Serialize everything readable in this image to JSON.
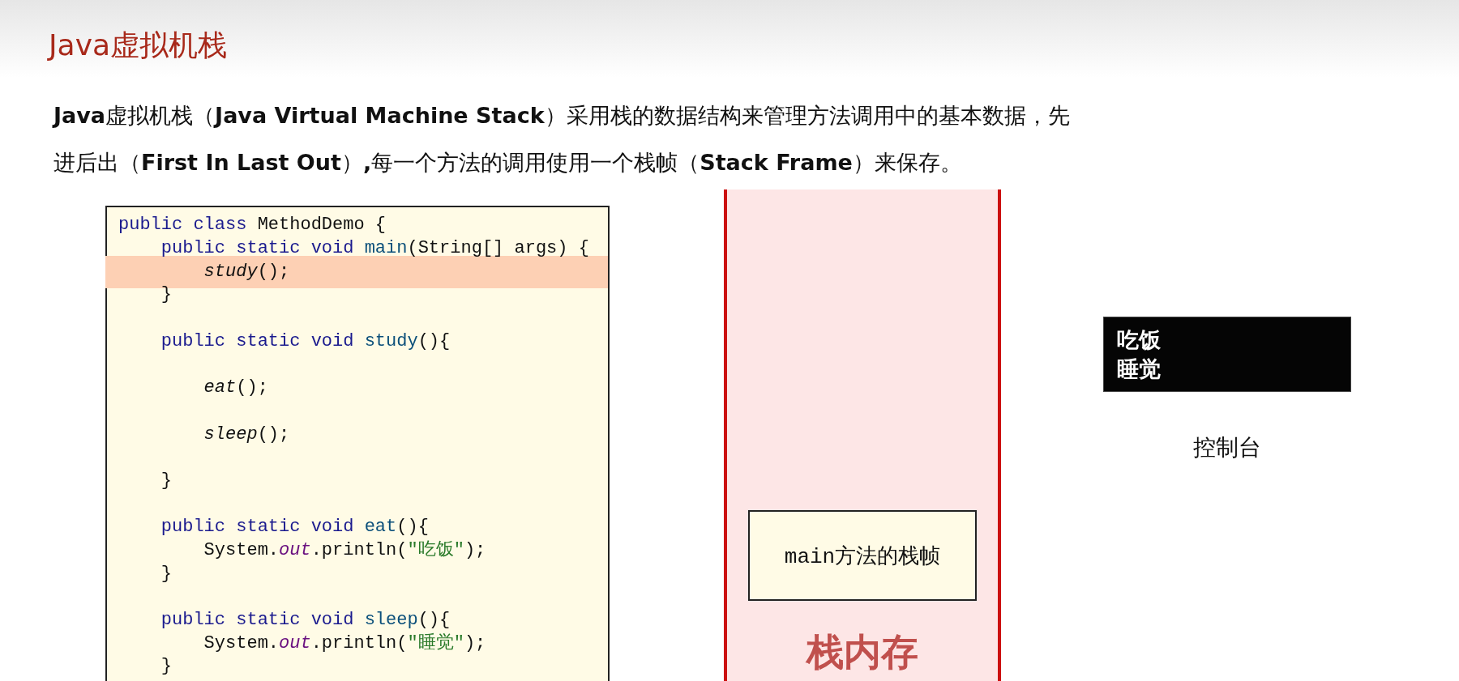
{
  "title": "Java虚拟机栈",
  "paragraph": [
    "**Java**虚拟机栈（**Java Virtual Machine Stack**）采用栈的数据结构来管理方法调用中的基本数据，先",
    "进后出（**First In Last Out**）**,**每一个方法的调用使用一个栈帧（**Stack Frame**）来保存。"
  ],
  "code": {
    "lines": [
      {
        "kind": "code",
        "highlighted": false,
        "tokens": [
          {
            "kind": "keyword",
            "text": "public class "
          },
          {
            "kind": "plain",
            "text": "MethodDemo {"
          }
        ]
      },
      {
        "kind": "code",
        "highlighted": false,
        "tokens": [
          {
            "kind": "keyword",
            "text": "    public static void "
          },
          {
            "kind": "method",
            "text": "main"
          },
          {
            "kind": "plain",
            "text": "(String[] args) {"
          }
        ]
      },
      {
        "kind": "code",
        "highlighted": true,
        "tokens": [
          {
            "kind": "call",
            "text": "        study"
          },
          {
            "kind": "plain",
            "text": "();"
          }
        ]
      },
      {
        "kind": "code",
        "highlighted": false,
        "tokens": [
          {
            "kind": "plain",
            "text": "    }"
          }
        ]
      },
      {
        "kind": "blank"
      },
      {
        "kind": "code",
        "highlighted": false,
        "tokens": [
          {
            "kind": "keyword",
            "text": "    public static void "
          },
          {
            "kind": "method",
            "text": "study"
          },
          {
            "kind": "plain",
            "text": "(){"
          }
        ]
      },
      {
        "kind": "blank"
      },
      {
        "kind": "code",
        "highlighted": false,
        "tokens": [
          {
            "kind": "call",
            "text": "        eat"
          },
          {
            "kind": "plain",
            "text": "();"
          }
        ]
      },
      {
        "kind": "blank"
      },
      {
        "kind": "code",
        "highlighted": false,
        "tokens": [
          {
            "kind": "call",
            "text": "        sleep"
          },
          {
            "kind": "plain",
            "text": "();"
          }
        ]
      },
      {
        "kind": "blank"
      },
      {
        "kind": "code",
        "highlighted": false,
        "tokens": [
          {
            "kind": "plain",
            "text": "    }"
          }
        ]
      },
      {
        "kind": "blank"
      },
      {
        "kind": "code",
        "highlighted": false,
        "tokens": [
          {
            "kind": "keyword",
            "text": "    public static void "
          },
          {
            "kind": "method",
            "text": "eat"
          },
          {
            "kind": "plain",
            "text": "(){"
          }
        ]
      },
      {
        "kind": "code",
        "highlighted": false,
        "tokens": [
          {
            "kind": "plain",
            "text": "        System."
          },
          {
            "kind": "field",
            "text": "out"
          },
          {
            "kind": "plain",
            "text": ".println("
          },
          {
            "kind": "string",
            "text": "\"吃饭\""
          },
          {
            "kind": "plain",
            "text": ");"
          }
        ]
      },
      {
        "kind": "code",
        "highlighted": false,
        "tokens": [
          {
            "kind": "plain",
            "text": "    }"
          }
        ]
      },
      {
        "kind": "blank"
      },
      {
        "kind": "code",
        "highlighted": false,
        "tokens": [
          {
            "kind": "keyword",
            "text": "    public static void "
          },
          {
            "kind": "method",
            "text": "sleep"
          },
          {
            "kind": "plain",
            "text": "(){"
          }
        ]
      },
      {
        "kind": "code",
        "highlighted": false,
        "tokens": [
          {
            "kind": "plain",
            "text": "        System."
          },
          {
            "kind": "field",
            "text": "out"
          },
          {
            "kind": "plain",
            "text": ".println("
          },
          {
            "kind": "string",
            "text": "\"睡觉\""
          },
          {
            "kind": "plain",
            "text": ");"
          }
        ]
      },
      {
        "kind": "code",
        "highlighted": false,
        "tokens": [
          {
            "kind": "plain",
            "text": "    }"
          }
        ]
      }
    ]
  },
  "stack": {
    "frames": [
      "main方法的栈帧"
    ],
    "label": "栈内存"
  },
  "console": {
    "lines": [
      "吃饭",
      "睡觉"
    ],
    "label": "控制台"
  }
}
